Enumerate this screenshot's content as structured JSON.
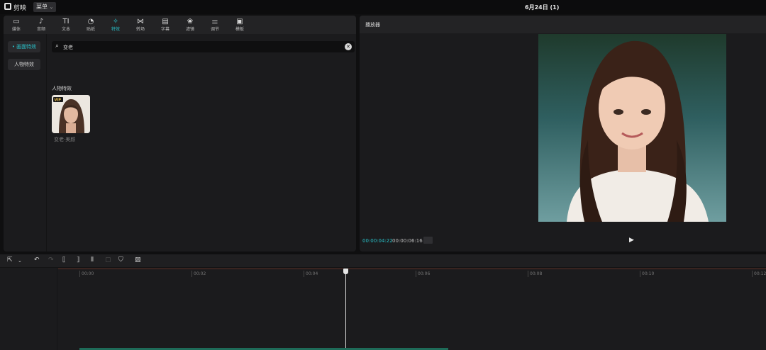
{
  "titlebar": {
    "app_name": "剪映",
    "menu_label": "菜单",
    "doc_title": "6月24日 (1)"
  },
  "toolbar": {
    "tools": [
      {
        "icon": "media-icon",
        "glyph": "▭",
        "label": "媒体"
      },
      {
        "icon": "audio-icon",
        "glyph": "♪",
        "label": "音频"
      },
      {
        "icon": "text-icon",
        "glyph": "TI",
        "label": "文本"
      },
      {
        "icon": "sticker-icon",
        "glyph": "◔",
        "label": "贴纸"
      },
      {
        "icon": "effects-icon",
        "glyph": "✧",
        "label": "特效"
      },
      {
        "icon": "transition-icon",
        "glyph": "⋈",
        "label": "转场"
      },
      {
        "icon": "caption-icon",
        "glyph": "▤",
        "label": "字幕"
      },
      {
        "icon": "filter-icon",
        "glyph": "❀",
        "label": "滤镜"
      },
      {
        "icon": "adjust-icon",
        "glyph": "⚌",
        "label": "调节"
      },
      {
        "icon": "template-icon",
        "glyph": "▣",
        "label": "模板"
      }
    ],
    "active_label": "特效"
  },
  "sidebar": {
    "items": [
      "• 画面特效",
      "人物特效"
    ]
  },
  "search": {
    "value": "变老"
  },
  "results": {
    "section": "人物特效",
    "card_name": "变老·美颜",
    "badge": "VIP"
  },
  "player": {
    "title": "播放器",
    "current_time": "00:00:04:22",
    "total_time": "00:00:06:16"
  },
  "timeline": {
    "ticks": [
      "00:00",
      "00:02",
      "00:04",
      "00:06",
      "00:08",
      "00:10",
      "00:12"
    ]
  },
  "colors": {
    "accent": "#29c1c9",
    "panel": "#1b1b1d",
    "background": "#0f0f10"
  }
}
